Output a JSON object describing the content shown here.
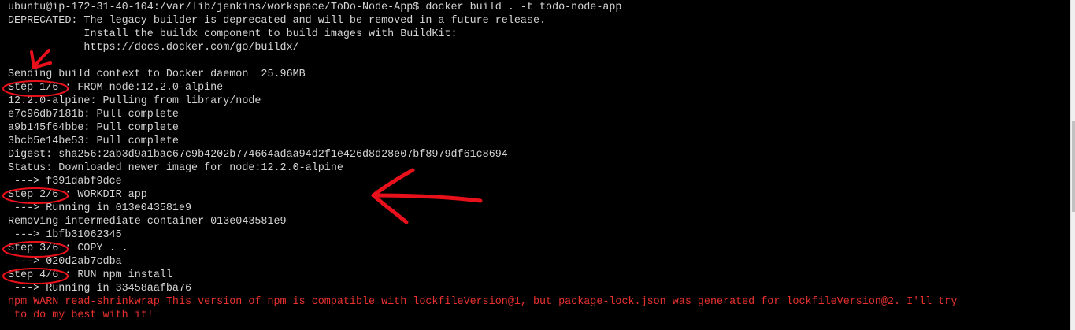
{
  "terminal": {
    "lines": [
      {
        "text": "ubuntu@ip-172-31-40-104:/var/lib/jenkins/workspace/ToDo-Node-App$ docker build . -t todo-node-app",
        "style": "normal"
      },
      {
        "text": "DEPRECATED: The legacy builder is deprecated and will be removed in a future release.",
        "style": "normal"
      },
      {
        "text": "            Install the buildx component to build images with BuildKit:",
        "style": "normal"
      },
      {
        "text": "            https://docs.docker.com/go/buildx/",
        "style": "normal"
      },
      {
        "text": "",
        "style": "blank"
      },
      {
        "text": "Sending build context to Docker daemon  25.96MB",
        "style": "normal"
      },
      {
        "text": "Step 1/6 : FROM node:12.2.0-alpine",
        "style": "normal"
      },
      {
        "text": "12.2.0-alpine: Pulling from library/node",
        "style": "normal"
      },
      {
        "text": "e7c96db7181b: Pull complete",
        "style": "normal"
      },
      {
        "text": "a9b145f64bbe: Pull complete",
        "style": "normal"
      },
      {
        "text": "3bcb5e14be53: Pull complete",
        "style": "normal"
      },
      {
        "text": "Digest: sha256:2ab3d9a1bac67c9b4202b774664adaa94d2f1e426d8d28e07bf8979df61c8694",
        "style": "normal"
      },
      {
        "text": "Status: Downloaded newer image for node:12.2.0-alpine",
        "style": "normal"
      },
      {
        "text": " ---> f391dabf9dce",
        "style": "normal"
      },
      {
        "text": "Step 2/6 : WORKDIR app",
        "style": "normal"
      },
      {
        "text": " ---> Running in 013e043581e9",
        "style": "normal"
      },
      {
        "text": "Removing intermediate container 013e043581e9",
        "style": "normal"
      },
      {
        "text": " ---> 1bfb31062345",
        "style": "normal"
      },
      {
        "text": "Step 3/6 : COPY . .",
        "style": "normal"
      },
      {
        "text": " ---> 020d2ab7cdba",
        "style": "normal"
      },
      {
        "text": "Step 4/6 : RUN npm install",
        "style": "normal"
      },
      {
        "text": " ---> Running in 33458aafba76",
        "style": "normal"
      },
      {
        "text": "npm WARN read-shrinkwrap This version of npm is compatible with lockfileVersion@1, but package-lock.json was generated for lockfileVersion@2. I'll try",
        "style": "warn"
      },
      {
        "text": " to do my best with it!",
        "style": "warn"
      }
    ]
  },
  "colors": {
    "background": "#000000",
    "foreground": "#d4d4d4",
    "warning": "#e8312f",
    "annotation": "#e8101a"
  },
  "annotations": {
    "circled_step_lines": [
      6,
      14,
      18,
      20
    ],
    "arrows": [
      "arrow-down-icon",
      "arrow-left-icon"
    ]
  }
}
